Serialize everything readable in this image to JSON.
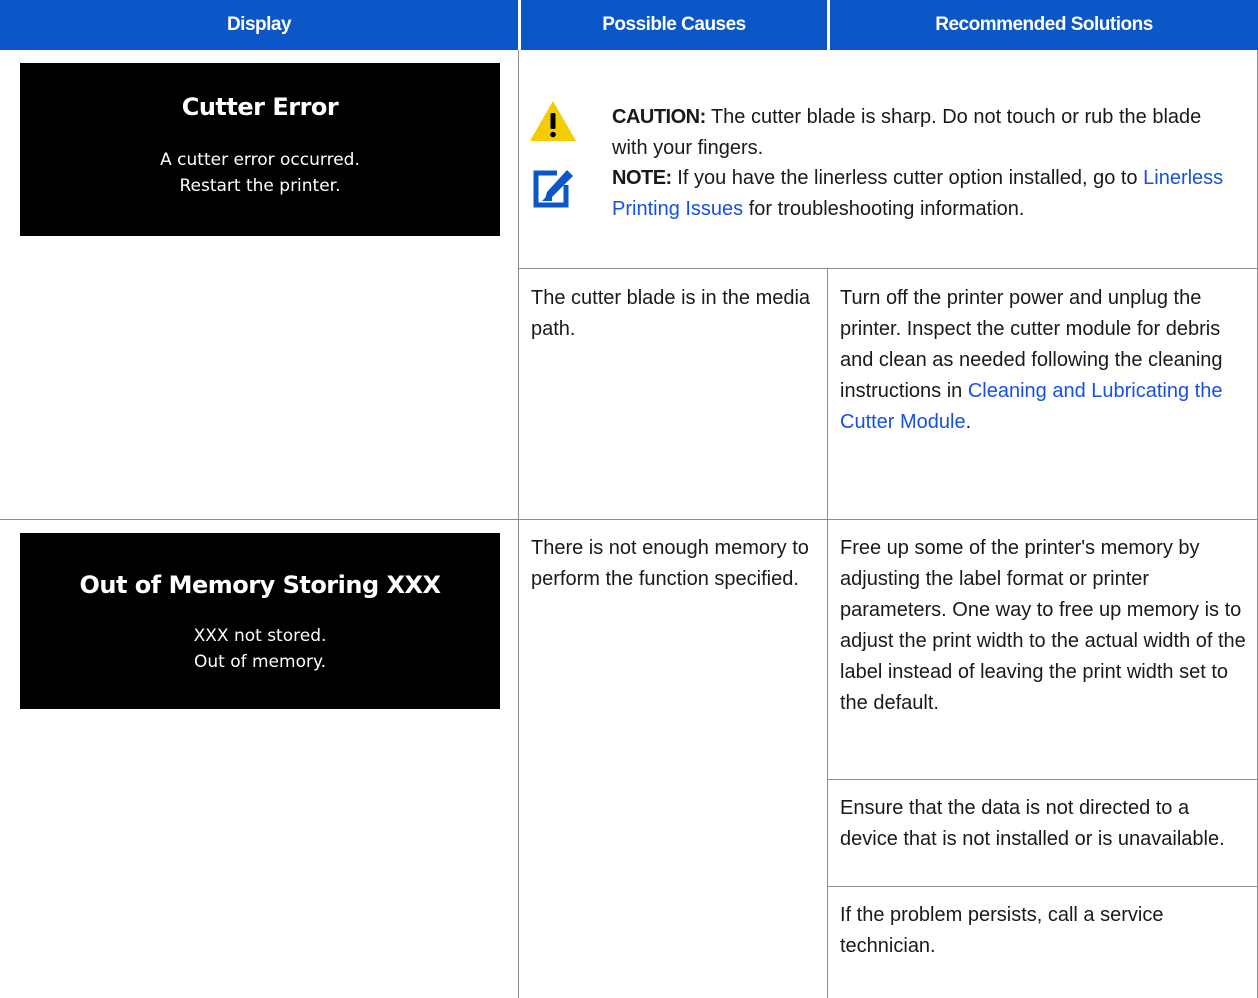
{
  "header": {
    "col1": "Display",
    "col2": "Possible Causes",
    "col3": "Recommended Solutions"
  },
  "rows": [
    {
      "display": {
        "title": "Cutter Error",
        "line1": "A cutter error occurred.",
        "line2": "Restart the printer."
      },
      "caution": {
        "label": "CAUTION:",
        "text": "The cutter blade is sharp. Do not touch or rub the blade with your fingers."
      },
      "note": {
        "label": "NOTE:",
        "text_before": "If you have the linerless cutter option installed, go to",
        "link": "Linerless Printing Issues",
        "text_after": "for troubleshooting information."
      },
      "cause": "The cutter blade is in the media path.",
      "solution": {
        "text": "Turn off the printer power and unplug the printer. Inspect the cutter module for debris and clean as needed following the cleaning instructions in",
        "link": "Cleaning and Lubricating the Cutter Module",
        "end": "."
      }
    },
    {
      "display": {
        "title": "Out of Memory Storing XXX",
        "line1": "XXX not stored.",
        "line2": "Out of memory."
      },
      "cause": "There is not enough memory to perform the function specified.",
      "solutions": [
        "Free up some of the printer's memory by adjusting the label format or printer parameters. One way to free up memory is to adjust the print width to the actual width of the label instead of leaving the print width set to the default.",
        "Ensure that the data is not directed to a device that is not installed or is unavailable.",
        "If the problem persists, call a service technician."
      ]
    }
  ],
  "colors": {
    "header_bg": "#0b57c8",
    "link": "#1551e6",
    "caution_yellow": "#f5cc00",
    "note_blue": "#0b57c8"
  },
  "icons": [
    "caution-icon",
    "note-icon"
  ]
}
